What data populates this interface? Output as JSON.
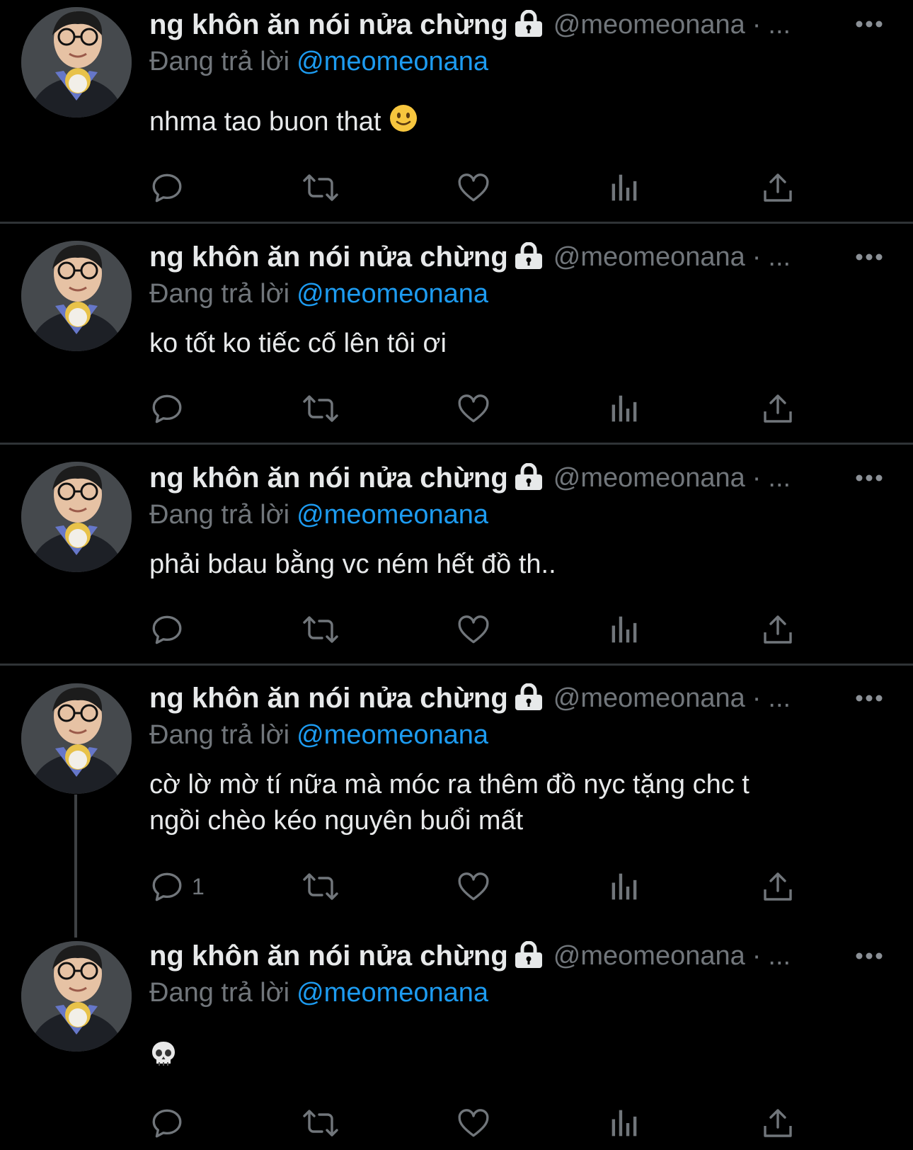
{
  "author": {
    "display_name": "ng khôn ăn nói nửa chừng",
    "handle": "@meomeonana",
    "dot": "·",
    "ellipsis": "..."
  },
  "reply_label": "Đang trả lời",
  "reply_mention": "@meomeonana",
  "icons": {
    "lock": "lock-icon",
    "more": "more-icon",
    "reply": "reply-icon",
    "retweet": "retweet-icon",
    "like": "heart-icon",
    "views": "analytics-icon",
    "share": "share-icon"
  },
  "colors": {
    "background": "#000000",
    "text": "#e7e9ea",
    "muted": "#71767b",
    "mention": "#1d9bf0",
    "divider": "#2f3336"
  },
  "tweets": [
    {
      "text": "nhma tao buon that",
      "emoji": "slightly-smiling-face",
      "reply_count": ""
    },
    {
      "text": "ko tốt ko tiếc cố lên tôi ơi",
      "reply_count": ""
    },
    {
      "text": "phải bdau bằng vc ném hết đồ th..",
      "reply_count": ""
    },
    {
      "text_line1": "cờ lờ mờ tí nữa mà móc ra thêm đồ nyc tặng chc t",
      "text_line2": "ngồi chèo kéo nguyên buổi mất",
      "reply_count": "1"
    },
    {
      "text": "",
      "emoji": "skull",
      "reply_count": ""
    }
  ]
}
